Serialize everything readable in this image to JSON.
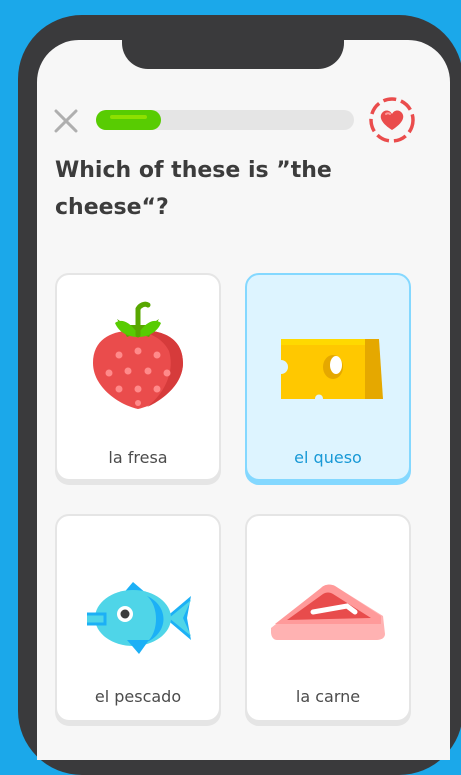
{
  "header": {
    "close_icon": "close-icon",
    "progress_fraction": 0.25,
    "heart_icon": "heart-icon",
    "colors": {
      "progress": "#58cc02",
      "heart": "#ea4c4c",
      "selected": "#1899d6"
    }
  },
  "question": {
    "line1": "Which of these is ”the",
    "line2": "cheese“?"
  },
  "options": [
    {
      "label": "la fresa",
      "icon": "strawberry-icon",
      "selected": false
    },
    {
      "label": "el queso",
      "icon": "cheese-icon",
      "selected": true
    },
    {
      "label": "el pescado",
      "icon": "fish-icon",
      "selected": false
    },
    {
      "label": "la carne",
      "icon": "meat-icon",
      "selected": false
    }
  ]
}
